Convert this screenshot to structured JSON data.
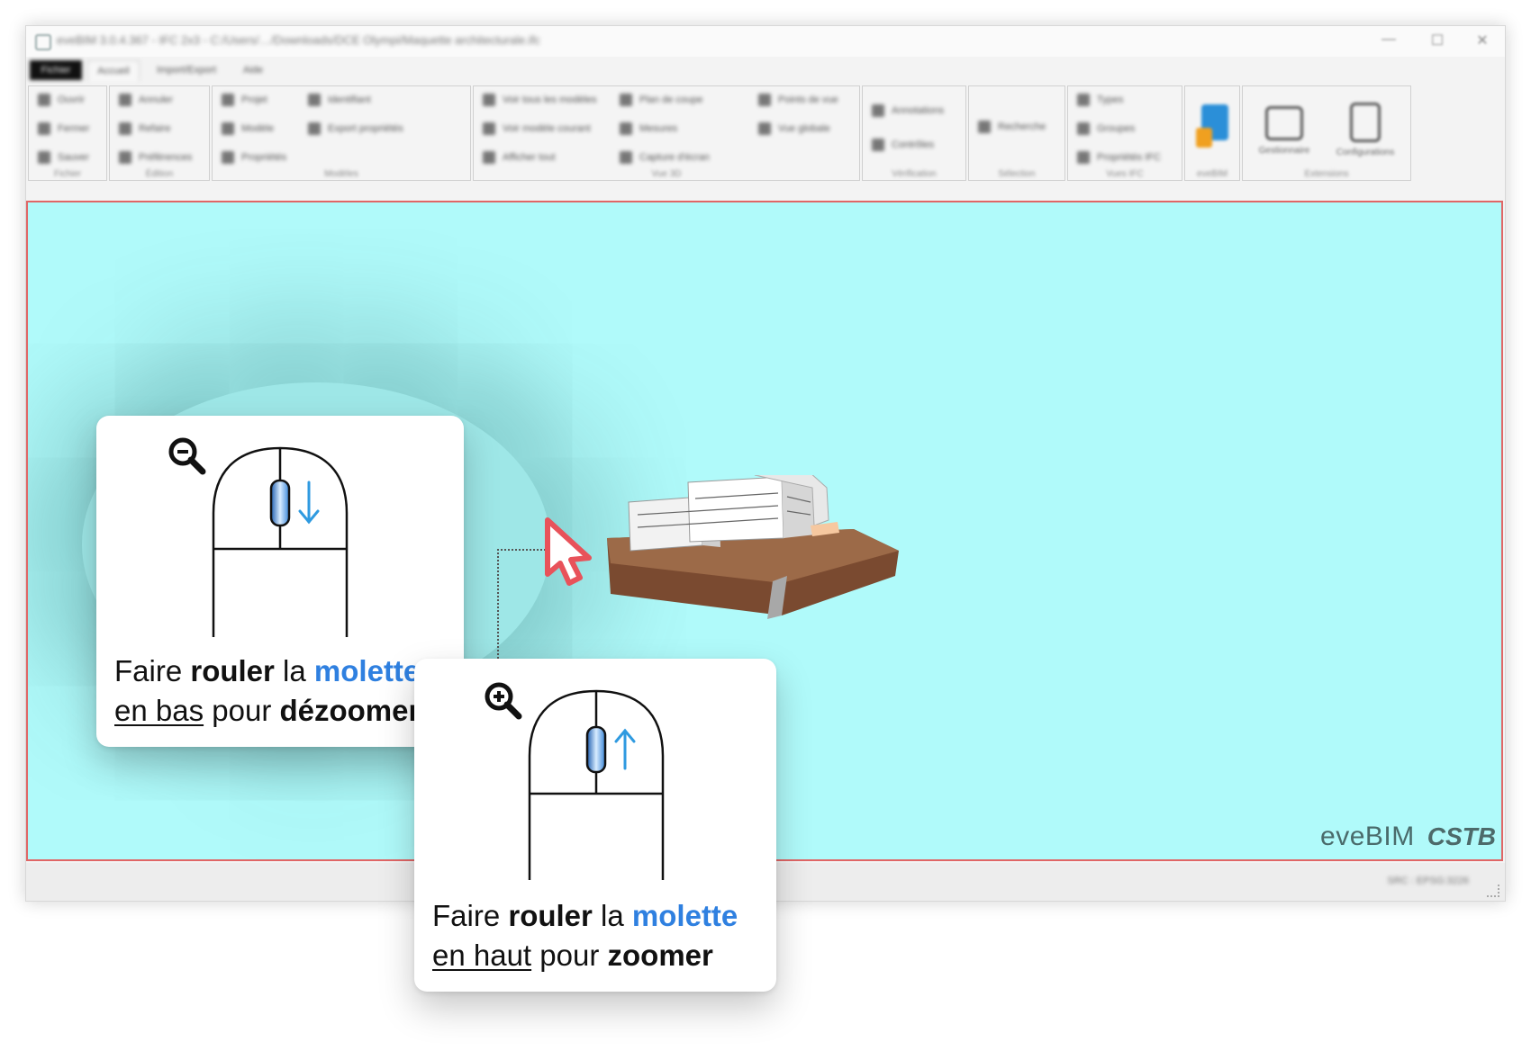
{
  "window": {
    "title": "eveBIM 3.0.4.367 - IFC 2x3 - C:/Users/…/Downloads/DCE Olympi/Maquette architecturale.ifc",
    "controls": [
      "—",
      "☐",
      "✕"
    ]
  },
  "menu_tabs": [
    "Fichier",
    "Accueil",
    "Import/Export",
    "Aide"
  ],
  "ribbon": {
    "groups": [
      {
        "name": "Fichier",
        "items": [
          "Ouvrir",
          "Fermer",
          "Sauver"
        ]
      },
      {
        "name": "Édition",
        "items": [
          "Annuler",
          "Refaire",
          "Préférences"
        ]
      },
      {
        "name": "Modèles",
        "items": [
          "Projet",
          "Modèle",
          "Propriétés",
          "Identifiant",
          "Export propriétés"
        ]
      },
      {
        "name": "Vue 3D",
        "items": [
          "Voir tous les modèles",
          "Voir modèle courant",
          "Afficher tout",
          "Plan de coupe",
          "Mesures",
          "Capture d'écran",
          "Points de vue",
          "Vue globale"
        ]
      },
      {
        "name": "Vérification",
        "items": [
          "Annotations",
          "Contrôles"
        ]
      },
      {
        "name": "Sélection",
        "items": [
          "Recherche"
        ]
      },
      {
        "name": "Vues IFC",
        "items": [
          "Types",
          "Groupes",
          "Propriétés IFC"
        ]
      },
      {
        "name": "eveBIM",
        "items": [
          ""
        ]
      },
      {
        "name": "Extensions",
        "items": [
          "Gestionnaire",
          "Configurations"
        ]
      }
    ]
  },
  "status": {
    "text": "SRC : EPSG:3226"
  },
  "brand": {
    "eve": "eveBIM",
    "cstb": "CSTB"
  },
  "callouts": {
    "zoom_out": {
      "w1": "Faire ",
      "w2": "rouler",
      "w3": " la ",
      "w4": "molette",
      "w5": "en bas",
      "w6": " pour ",
      "w7": "dézoomer"
    },
    "zoom_in": {
      "w1": "Faire ",
      "w2": "rouler",
      "w3": " la ",
      "w4": "molette",
      "w5": "en haut",
      "w6": " pour ",
      "w7": "zoomer"
    }
  },
  "colors": {
    "viewport_bg": "#b0fafa",
    "viewport_border": "#e06666",
    "accent_blue": "#2f80e0",
    "cursor_red": "#e8525a",
    "soil_brown": "#7a4a30"
  }
}
